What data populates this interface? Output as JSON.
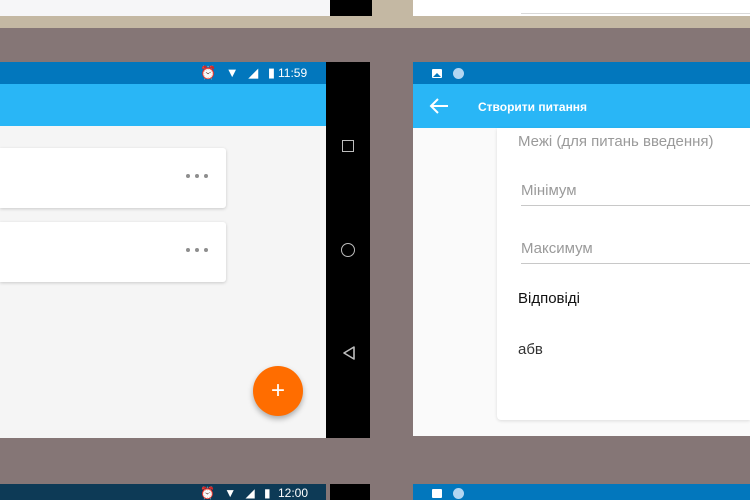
{
  "left_screen": {
    "status_icons": "⏰ ▼ ◢ ▮",
    "status_time": "11:59",
    "fab_label": "+"
  },
  "right_screen": {
    "title": "Створити питання",
    "limits_label": "Межі (для питань введення)",
    "min_placeholder": "Мінімум",
    "max_placeholder": "Максимум",
    "answers_heading": "Відповіді",
    "answer_item": "абв"
  },
  "bottom_left": {
    "status_icons": "⏰ ▼ ◢ ▮",
    "status_time": "12:00"
  },
  "colors": {
    "status_bar": "#0277bd",
    "app_bar": "#29b6f6",
    "fab": "#ff6d00",
    "background": "#857676"
  },
  "icons": [
    "alarm-icon",
    "wifi-icon",
    "signal-icon",
    "battery-icon",
    "more-icon",
    "add-icon",
    "back-arrow-icon",
    "image-notification-icon",
    "nav-recents-icon",
    "nav-home-icon",
    "nav-back-icon"
  ]
}
